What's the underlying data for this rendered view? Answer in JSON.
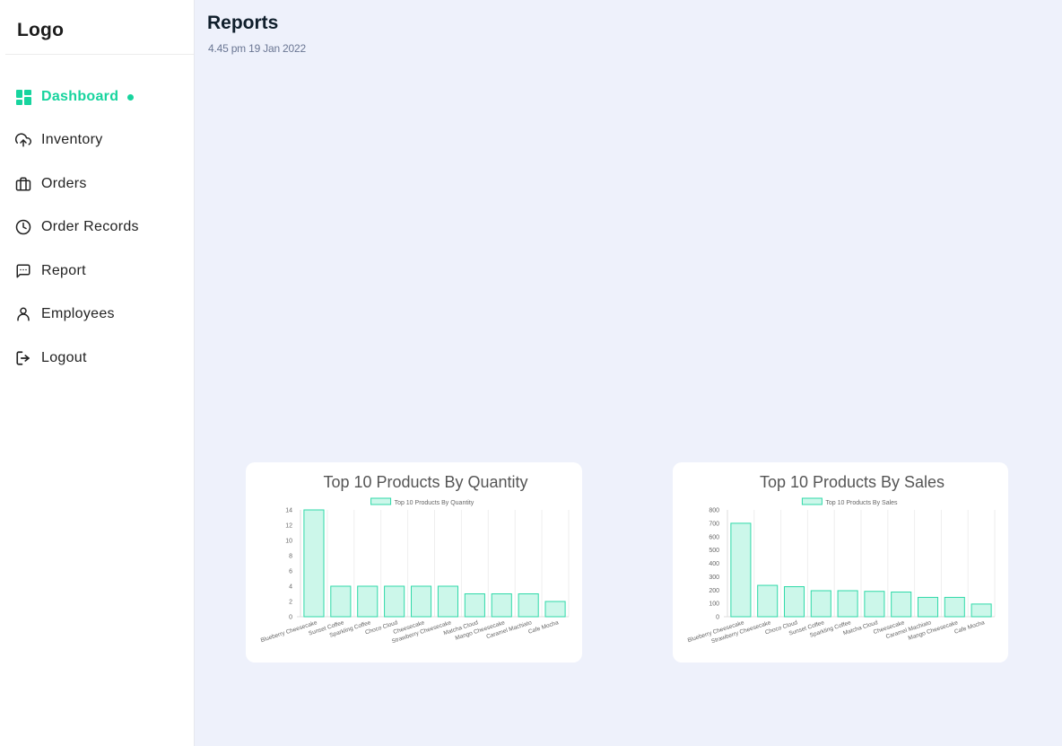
{
  "sidebar": {
    "logo": "Logo",
    "items": [
      {
        "label": "Dashboard",
        "icon": "grid-icon",
        "active": true
      },
      {
        "label": "Inventory",
        "icon": "upload-cloud-icon"
      },
      {
        "label": "Orders",
        "icon": "briefcase-icon"
      },
      {
        "label": "Order Records",
        "icon": "clock-icon"
      },
      {
        "label": "Report",
        "icon": "message-square-icon"
      },
      {
        "label": "Employees",
        "icon": "user-icon"
      },
      {
        "label": "Logout",
        "icon": "logout-icon"
      }
    ]
  },
  "main": {
    "title": "Reports",
    "timestamp": "4.45 pm 19 Jan 2022"
  },
  "colors": {
    "accent": "#17d49e",
    "bar_fill": "#ccf7ea",
    "bar_stroke": "#2fd9a8"
  },
  "chart_data": [
    {
      "type": "bar",
      "title": "Top 10 Products By Quantity",
      "legend": "Top 10 Products By Quantity",
      "legend_position": "top",
      "categories": [
        "Blueberry Cheesecake",
        "Sunset Coffee",
        "Sparkling Coffee",
        "Choco Cloud",
        "Cheesecake",
        "Strawberry Cheesecake",
        "Matcha Cloud",
        "Mango Cheesecake",
        "Caramel Machiato",
        "Cafe Mocha"
      ],
      "values": [
        14,
        4,
        4,
        4,
        4,
        4,
        3,
        3,
        3,
        2
      ],
      "ylim": [
        0,
        14
      ],
      "yticks": [
        0,
        2,
        4,
        6,
        8,
        10,
        12,
        14
      ],
      "grid": true
    },
    {
      "type": "bar",
      "title": "Top 10 Products By Sales",
      "legend": "Top 10 Products By Sales",
      "legend_position": "top",
      "categories": [
        "Blueberry Cheesecake",
        "Strawberry Cheesecake",
        "Choco Cloud",
        "Sunset Coffee",
        "Sparkling Coffee",
        "Matcha Cloud",
        "Cheesecake",
        "Caramel Machiato",
        "Mango Cheesecake",
        "Cafe Mocha"
      ],
      "values": [
        700,
        235,
        225,
        195,
        195,
        190,
        185,
        145,
        145,
        95
      ],
      "ylim": [
        0,
        800
      ],
      "yticks": [
        0,
        100,
        200,
        300,
        400,
        500,
        600,
        700,
        800
      ],
      "grid": true
    }
  ]
}
